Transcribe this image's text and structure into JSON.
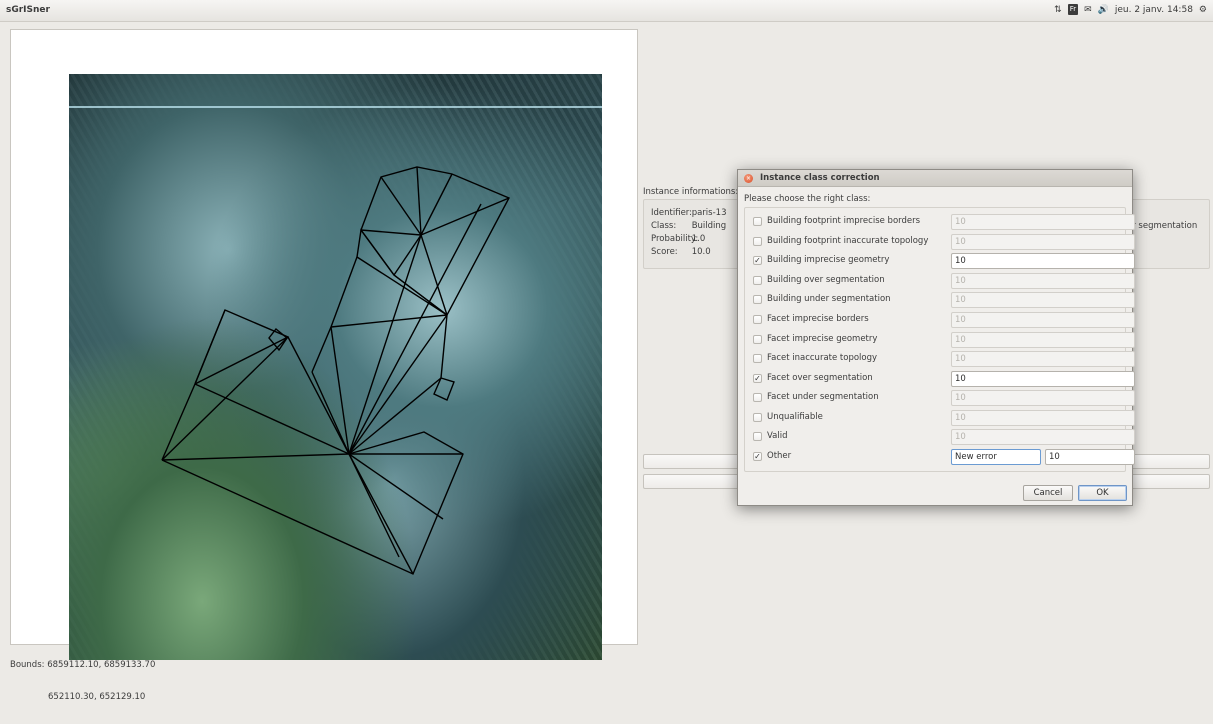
{
  "app": {
    "title": "sGrISner"
  },
  "tray": {
    "keyboard_badge": "Fr",
    "datetime": "jeu. 2 janv. 14:58",
    "icons": [
      "network-icon",
      "keyboard-icon",
      "mail-icon",
      "volume-icon",
      "gear-icon"
    ]
  },
  "map": {
    "bounds_label": "Bounds: 6859112.10, 6859133.70",
    "bounds_label2": "652110.30, 652129.10"
  },
  "instance": {
    "title": "Instance informations:",
    "identifier_key": "Identifier:",
    "identifier_value": "paris-13",
    "class_key": "Class:",
    "class_value": "Building",
    "probability_key": "Probability:",
    "probability_value": "1.0",
    "score_key": "Score:",
    "score_value": "10.0",
    "right_text": "er segmentation"
  },
  "dialog": {
    "title": "Instance class correction",
    "prompt": "Please choose the right class:",
    "options": [
      {
        "label": "Building footprint imprecise borders",
        "checked": false,
        "value": "10"
      },
      {
        "label": "Building footprint inaccurate topology",
        "checked": false,
        "value": "10"
      },
      {
        "label": "Building imprecise geometry",
        "checked": true,
        "value": "10"
      },
      {
        "label": "Building over segmentation",
        "checked": false,
        "value": "10"
      },
      {
        "label": "Building under segmentation",
        "checked": false,
        "value": "10"
      },
      {
        "label": "Facet imprecise borders",
        "checked": false,
        "value": "10"
      },
      {
        "label": "Facet imprecise geometry",
        "checked": false,
        "value": "10"
      },
      {
        "label": "Facet inaccurate topology",
        "checked": false,
        "value": "10"
      },
      {
        "label": "Facet over segmentation",
        "checked": true,
        "value": "10"
      },
      {
        "label": "Facet under segmentation",
        "checked": false,
        "value": "10"
      },
      {
        "label": "Unqualifiable",
        "checked": false,
        "value": "10"
      },
      {
        "label": "Valid",
        "checked": false,
        "value": "10"
      },
      {
        "label": "Other",
        "checked": true,
        "value": "10",
        "name_value": "New error"
      }
    ],
    "cancel_label": "Cancel",
    "ok_label": "OK"
  }
}
